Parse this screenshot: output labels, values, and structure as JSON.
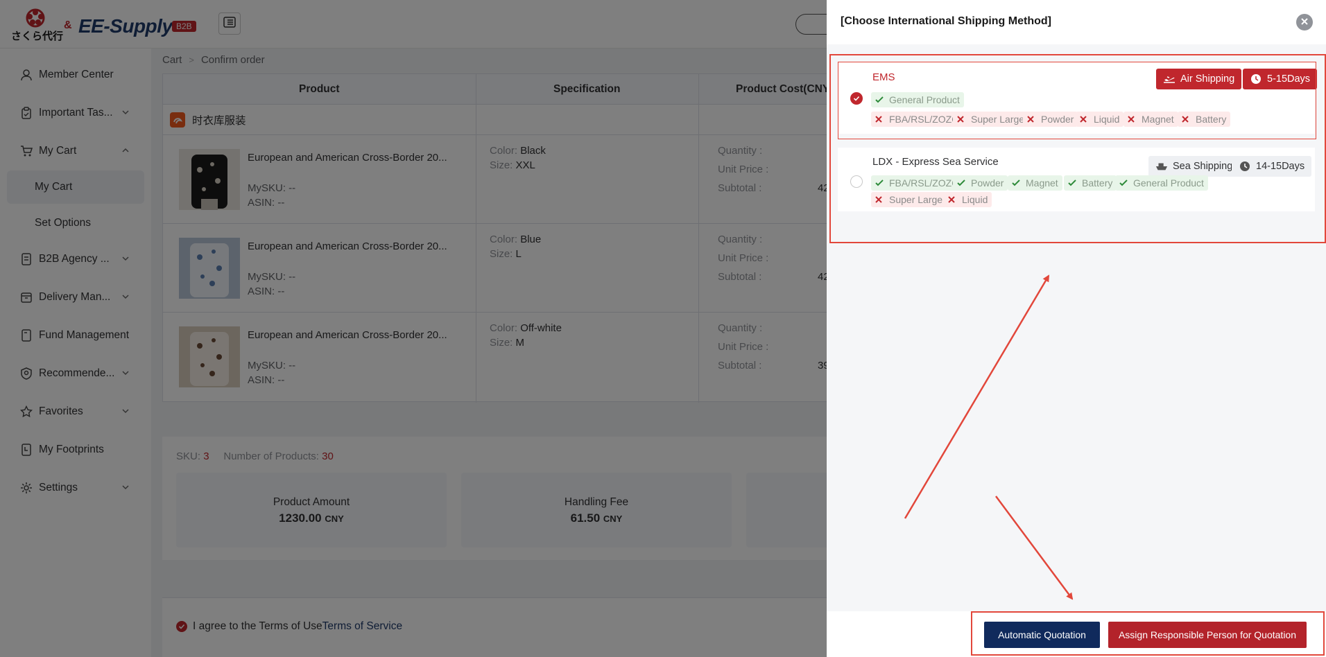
{
  "header": {
    "logo_left_text": "さくら代行",
    "logo_amp": "&",
    "logo_brand": "EE-Supply",
    "logo_badge": "B2B"
  },
  "sidebar": {
    "items": [
      {
        "label": "Member Center",
        "icon": "user-icon"
      },
      {
        "label": "Important Tas...",
        "icon": "clipboard-icon"
      },
      {
        "label": "My Cart",
        "icon": "cart-icon"
      },
      {
        "label": "My Cart",
        "icon": ""
      },
      {
        "label": "Set Options",
        "icon": ""
      },
      {
        "label": "B2B Agency ...",
        "icon": "document-icon"
      },
      {
        "label": "Delivery Man...",
        "icon": "box-icon"
      },
      {
        "label": "Fund Management",
        "icon": "wallet-icon"
      },
      {
        "label": "Recommende...",
        "icon": "badge-icon"
      },
      {
        "label": "Favorites",
        "icon": "star-icon"
      },
      {
        "label": "My Footprints",
        "icon": "footprint-icon"
      },
      {
        "label": "Settings",
        "icon": "gear-icon"
      }
    ]
  },
  "breadcrumb": {
    "items": [
      "Cart",
      "Confirm order"
    ]
  },
  "table": {
    "headers": [
      "Product",
      "Specification",
      "Product Cost(CNY"
    ],
    "store_name": "时衣库服装",
    "rows": [
      {
        "name": "European and American Cross-Border 20...",
        "mysku": "MySKU: --",
        "asin": "ASIN: --",
        "color_label": "Color: ",
        "color": "Black",
        "size_label": "Size: ",
        "size": "XXL",
        "quantity": "Quantity :",
        "unit_price": "Unit Price :",
        "subtotal": "Subtotal :",
        "subtotal_val": "42"
      },
      {
        "name": "European and American Cross-Border 20...",
        "mysku": "MySKU: --",
        "asin": "ASIN: --",
        "color_label": "Color: ",
        "color": "Blue",
        "size_label": "Size: ",
        "size": "L",
        "quantity": "Quantity :",
        "unit_price": "Unit Price :",
        "subtotal": "Subtotal :",
        "subtotal_val": "42"
      },
      {
        "name": "European and American Cross-Border 20...",
        "mysku": "MySKU: --",
        "asin": "ASIN: --",
        "color_label": "Color: ",
        "color": "Off-white",
        "size_label": "Size: ",
        "size": "M",
        "quantity": "Quantity :",
        "unit_price": "Unit Price :",
        "subtotal": "Subtotal :",
        "subtotal_val": "39"
      }
    ]
  },
  "summary": {
    "sku_label": "SKU:",
    "sku_value": "3",
    "products_label": "Number of Products:",
    "products_value": "30",
    "cards": [
      {
        "label": "Product Amount",
        "value": "1230.00",
        "unit": "CNY"
      },
      {
        "label": "Handling Fee",
        "value": "61.50",
        "unit": "CNY"
      }
    ]
  },
  "agreement": {
    "text": "I agree to the Terms of Use",
    "link": "Terms of Service"
  },
  "drawer": {
    "title": "[Choose International Shipping Method]",
    "options": [
      {
        "name": "EMS",
        "selected": true,
        "mode": "Air Shipping",
        "mode_icon": "airplane-icon",
        "days": "5-15Days",
        "allowed": [
          "General Product"
        ],
        "restricted": [
          "FBA/RSL/ZOZO",
          "Super Large",
          "Powder",
          "Liquid",
          "Magnet",
          "Battery"
        ]
      },
      {
        "name": "LDX - Express Sea Service",
        "selected": false,
        "mode": "Sea Shipping",
        "mode_icon": "ship-icon",
        "days": "14-15Days",
        "allowed": [
          "FBA/RSL/ZOZO",
          "Powder",
          "Magnet",
          "Battery",
          "General Product"
        ],
        "restricted": [
          "Super Large",
          "Liquid"
        ]
      }
    ],
    "buttons": {
      "auto": "Automatic Quotation",
      "assign": "Assign Responsible Person for Quotation"
    }
  },
  "colors": {
    "brand_red": "#c0272d",
    "navy": "#102a5c",
    "annotation_red": "#e2473b"
  }
}
